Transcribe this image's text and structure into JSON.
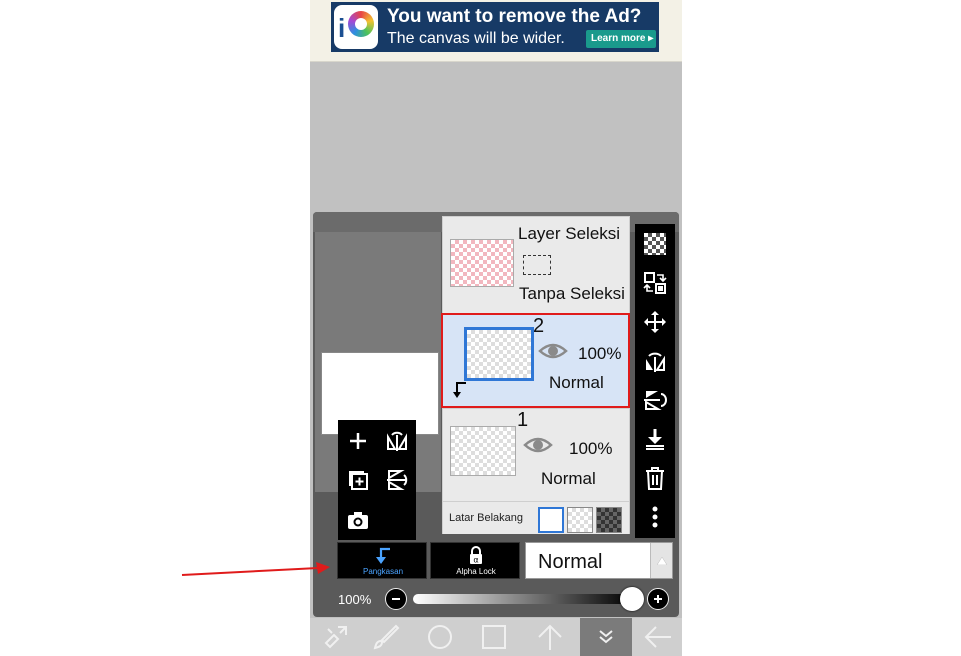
{
  "ad": {
    "title": "You want to remove the Ad?",
    "subtitle": "The canvas will be wider.",
    "button": "Learn more ▸"
  },
  "selection_layer": {
    "title": "Layer Seleksi",
    "status": "Tanpa Seleksi"
  },
  "layers": [
    {
      "number": "2",
      "opacity": "100%",
      "blend": "Normal",
      "selected": true
    },
    {
      "number": "1",
      "opacity": "100%",
      "blend": "Normal",
      "selected": false
    }
  ],
  "background": {
    "label": "Latar Belakang"
  },
  "controls": {
    "clipping_label": "Pangkasan",
    "alpha_lock_label": "Alpha Lock",
    "blend_mode": "Normal",
    "opacity_label": "100%",
    "opacity_value": 1.0
  },
  "icons": {
    "left_tools": [
      "add-layer-icon",
      "flip-horizontal-icon",
      "add-copy-icon",
      "flip-vertical-icon",
      "camera-icon"
    ],
    "right_tools": [
      "transparency-icon",
      "swap-layer-icon",
      "move-icon",
      "rotate-flip-icon",
      "flip-rotate-icon",
      "merge-down-icon",
      "trash-icon",
      "more-icon"
    ],
    "toolbar": [
      "transform-icon",
      "brush-icon",
      "circle-icon",
      "square-icon",
      "arrow-up-icon",
      "chevron-down-icon",
      "back-arrow-icon"
    ]
  },
  "colors": {
    "selection_highlight": "#e01b1b",
    "selected_layer_bg": "#d7e4f6",
    "accent_blue": "#2f77d6",
    "annotation_arrow": "#e01b1b"
  }
}
